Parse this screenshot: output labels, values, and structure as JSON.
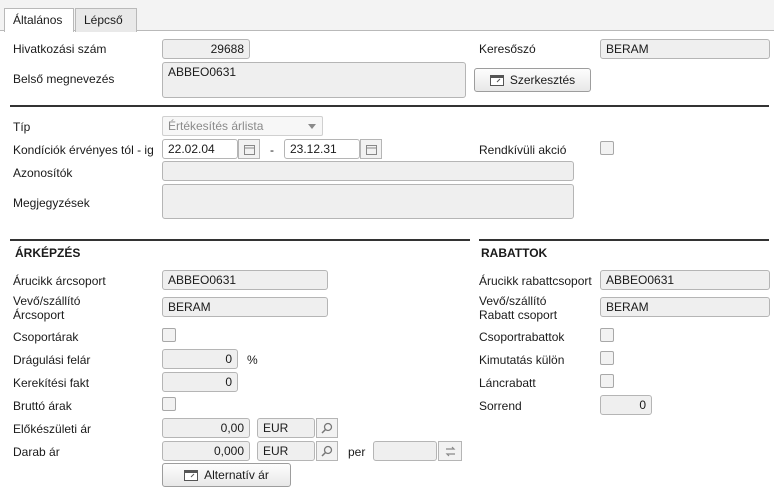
{
  "tabs": [
    "Általános",
    "Lépcső"
  ],
  "general": {
    "ref_label": "Hivatkozási szám",
    "ref_value": "29688",
    "internal_label": "Belső megnevezés",
    "internal_value": "ABBEO0631",
    "search_label": "Keresőszó",
    "search_value": "BERAM",
    "edit_button": "Szerkesztés"
  },
  "conditions": {
    "type_label": "Típ",
    "type_value": "Értékesítés árlista",
    "valid_label": "Kondíciók érvényes tól - ig",
    "valid_from": "22.02.04",
    "dash": "-",
    "valid_to": "23.12.31",
    "special_label": "Rendkívüli akció",
    "ids_label": "Azonosítók",
    "notes_label": "Megjegyzések"
  },
  "pricing": {
    "title": "ÁRKÉPZÉS",
    "item_group_label": "Árucikk árcsoport",
    "item_group_value": "ABBEO0631",
    "customer_group_label_1": "Vevő/szállító",
    "customer_group_label_2": "Árcsoport",
    "customer_group_value": "BERAM",
    "group_prices_label": "Csoportárak",
    "markup_label": "Drágulási felár",
    "markup_value": "0",
    "percent": "%",
    "rounding_label": "Kerekítési fakt",
    "rounding_value": "0",
    "gross_label": "Bruttó árak",
    "prep_label": "Előkészületi ár",
    "prep_value": "0,00",
    "prep_currency": "EUR",
    "unit_label": "Darab ár",
    "unit_value": "0,000",
    "unit_currency": "EUR",
    "per_label": "per",
    "alt_button": "Alternatív ár"
  },
  "discounts": {
    "title": "RABATTOK",
    "item_group_label": "Árucikk rabattcsoport",
    "item_group_value": "ABBEO0631",
    "customer_group_label_1": "Vevő/szállító",
    "customer_group_label_2": "Rabatt csoport",
    "customer_group_value": "BERAM",
    "group_discounts_label": "Csoportrabattok",
    "separate_label": "Kimutatás külön",
    "chain_label": "Láncrabatt",
    "order_label": "Sorrend",
    "order_value": "0"
  }
}
